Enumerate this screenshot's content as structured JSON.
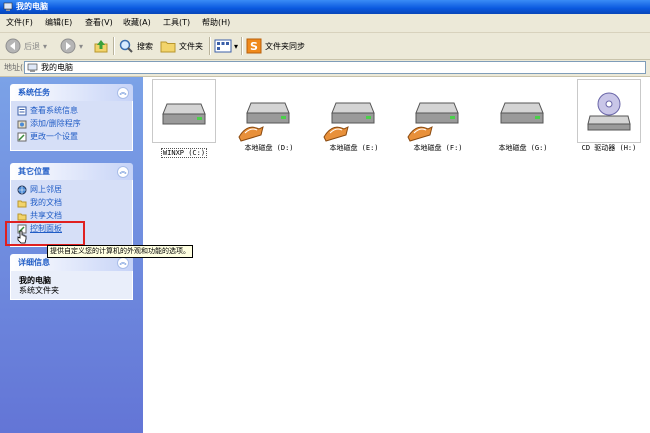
{
  "window": {
    "title": "我的电脑"
  },
  "menu": [
    "文件(F)",
    "编辑(E)",
    "查看(V)",
    "收藏(A)",
    "工具(T)",
    "帮助(H)"
  ],
  "toolbar": {
    "back": "后退",
    "search": "搜索",
    "folders": "文件夹",
    "sync": "文件夹同步"
  },
  "address": {
    "label": "地址(D)",
    "value": "我的电脑"
  },
  "system_tasks": {
    "title": "系统任务",
    "items": [
      "查看系统信息",
      "添加/删除程序",
      "更改一个设置"
    ]
  },
  "other_places": {
    "title": "其它位置",
    "items": [
      "网上邻居",
      "我的文档",
      "共享文档",
      "控制面板"
    ]
  },
  "details": {
    "title": "详细信息",
    "name": "我的电脑",
    "type": "系统文件夹"
  },
  "drives": [
    "WINXP (C:)",
    "本地磁盘 (D:)",
    "本地磁盘 (E:)",
    "本地磁盘 (F:)",
    "本地磁盘 (G:)",
    "CD 驱动器 (H:)"
  ],
  "tooltip": "提供自定义您的计算机的外观和功能的选项。",
  "colors": {
    "titlebar": "#0a58df",
    "taskpane": "#6375d6",
    "link": "#215dc6",
    "highlight": "#e02020"
  }
}
